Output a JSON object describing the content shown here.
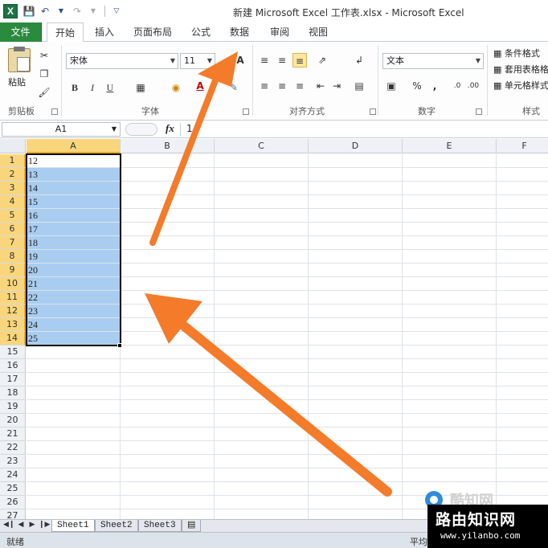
{
  "window": {
    "app_icon": "X",
    "title": "新建 Microsoft Excel 工作表.xlsx - Microsoft Excel"
  },
  "quick_access": [
    "save-icon",
    "undo-icon",
    "redo-icon",
    "customize-icon"
  ],
  "ribbon_tabs": {
    "file": "文件",
    "home": "开始",
    "insert": "插入",
    "layout": "页面布局",
    "formulas": "公式",
    "data": "数据",
    "review": "审阅",
    "view": "视图"
  },
  "ribbon": {
    "clipboard": {
      "paste": "粘贴",
      "label": "剪贴板"
    },
    "font": {
      "name": "宋体",
      "size": "11",
      "bold": "B",
      "italic": "I",
      "underline": "U",
      "grow": "A",
      "color": "A",
      "label": "字体"
    },
    "alignment": {
      "label": "对齐方式"
    },
    "number": {
      "format": "文本",
      "percent": "%",
      "comma": ",",
      "label": "数字"
    },
    "styles": {
      "conditional": "条件格式",
      "table": "套用表格格式",
      "cell": "单元格样式",
      "label": "样式"
    },
    "accent": "#2a8a3e"
  },
  "formula_bar": {
    "name_box": "A1",
    "fx": "fx",
    "value": "1"
  },
  "sheet": {
    "columns": [
      "A",
      "B",
      "C",
      "D",
      "E",
      "F"
    ],
    "rows": [
      "1",
      "2",
      "3",
      "4",
      "5",
      "6",
      "7",
      "8",
      "9",
      "10",
      "11",
      "12",
      "13",
      "14",
      "15",
      "16",
      "17",
      "18",
      "19",
      "20",
      "21",
      "22",
      "23",
      "24",
      "25",
      "26",
      "27"
    ],
    "column_a_values": [
      "12",
      "13",
      "14",
      "15",
      "16",
      "17",
      "18",
      "19",
      "20",
      "21",
      "22",
      "23",
      "24",
      "25"
    ],
    "selected_range": "A1:A14",
    "selection_color": "#a9cdf0",
    "header_highlight": "#f9d67b"
  },
  "sheet_tabs": [
    "Sheet1",
    "Sheet2",
    "Sheet3"
  ],
  "status": {
    "left": "就绪",
    "right": "平均"
  },
  "watermark": {
    "main": "路由知识网",
    "url": "www.yilanbo.com",
    "logo": "酷知网"
  },
  "annotation": {
    "arrow_color": "#f47b2a"
  }
}
